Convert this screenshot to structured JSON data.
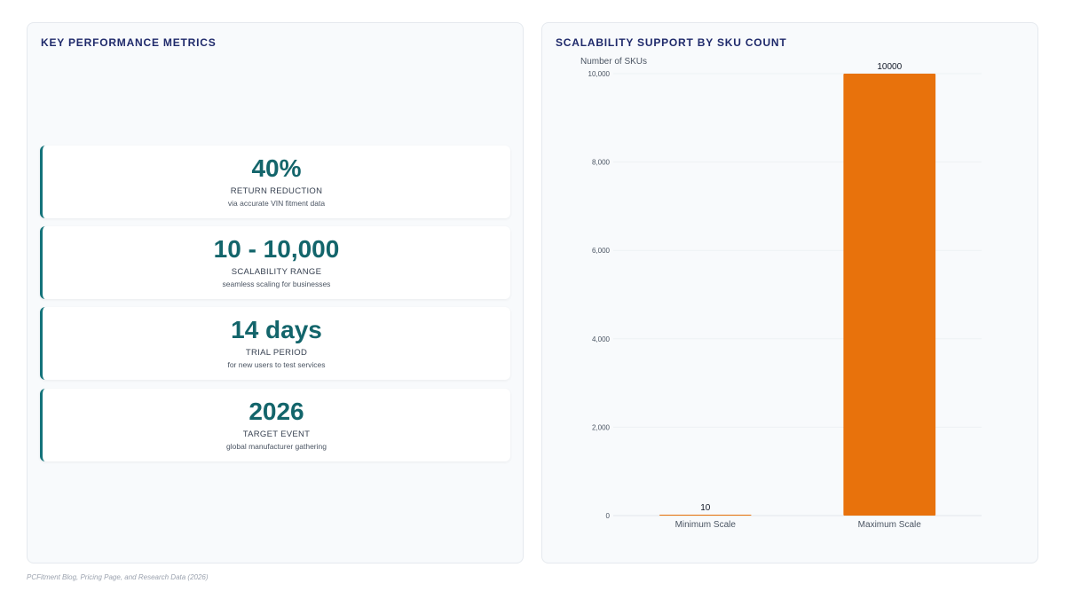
{
  "metrics_panel": {
    "title": "KEY PERFORMANCE METRICS",
    "cards": [
      {
        "value": "40%",
        "label": "RETURN REDUCTION",
        "sub": "via accurate VIN fitment data"
      },
      {
        "value": "10 - 10,000",
        "label": "SCALABILITY RANGE",
        "sub": "seamless scaling for businesses"
      },
      {
        "value": "14 days",
        "label": "TRIAL PERIOD",
        "sub": "for new users to test services"
      },
      {
        "value": "2026",
        "label": "TARGET EVENT",
        "sub": "global manufacturer gathering"
      }
    ]
  },
  "chart_panel": {
    "title": "SCALABILITY SUPPORT BY SKU COUNT"
  },
  "chart_data": {
    "type": "bar",
    "title": "SCALABILITY SUPPORT BY SKU COUNT",
    "categories": [
      "Minimum Scale",
      "Maximum Scale"
    ],
    "values": [
      10,
      10000
    ],
    "data_labels": [
      "10",
      "10000"
    ],
    "ylabel": "Number of SKUs",
    "xlabel": "",
    "ylim": [
      0,
      10000
    ],
    "yticks": [
      0,
      2000,
      4000,
      6000,
      8000,
      10000
    ],
    "ytick_labels": [
      "0",
      "2,000",
      "4,000",
      "6,000",
      "8,000",
      "10,000"
    ],
    "bar_color": "#e8720c",
    "grid": true,
    "legend": "none"
  },
  "colors": {
    "accent": "#13737a",
    "title": "#1f2a6b",
    "bar": "#e8720c"
  },
  "footer": {
    "source": "PCFitment Blog, Pricing Page, and Research Data (2026)"
  }
}
